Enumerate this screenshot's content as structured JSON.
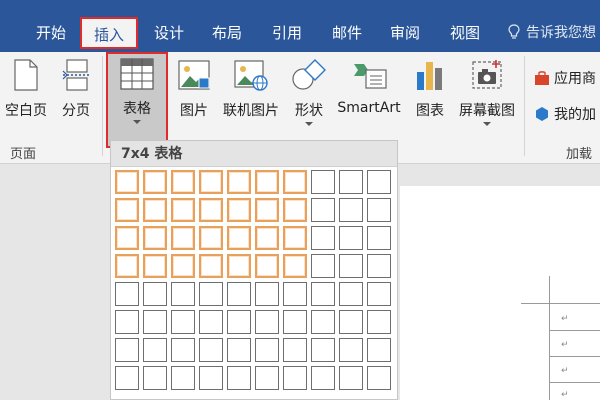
{
  "tabs": [
    {
      "label": "开始",
      "active": false
    },
    {
      "label": "插入",
      "active": true
    },
    {
      "label": "设计",
      "active": false
    },
    {
      "label": "布局",
      "active": false
    },
    {
      "label": "引用",
      "active": false
    },
    {
      "label": "邮件",
      "active": false
    },
    {
      "label": "审阅",
      "active": false
    },
    {
      "label": "视图",
      "active": false
    }
  ],
  "tell_me": "告诉我您想",
  "ribbon": {
    "blank_page": "空白页",
    "page_break": "分页",
    "table": "表格",
    "picture": "图片",
    "online_picture": "联机图片",
    "shapes": "形状",
    "smartart": "SmartArt",
    "chart": "图表",
    "screenshot": "屏幕截图",
    "store": "应用商",
    "my_addins": "我的加",
    "group_pages": "页面",
    "group_addins": "加载"
  },
  "table_grid": {
    "header": "7x4 表格",
    "columns": 10,
    "rows": 8,
    "selected_cols": 7,
    "selected_rows": 4
  },
  "colors": {
    "ribbon_blue": "#2b579a",
    "highlight_red": "#e02b2b",
    "selection_orange": "#e8a15c"
  },
  "doc": {
    "para_mark": "↵"
  }
}
